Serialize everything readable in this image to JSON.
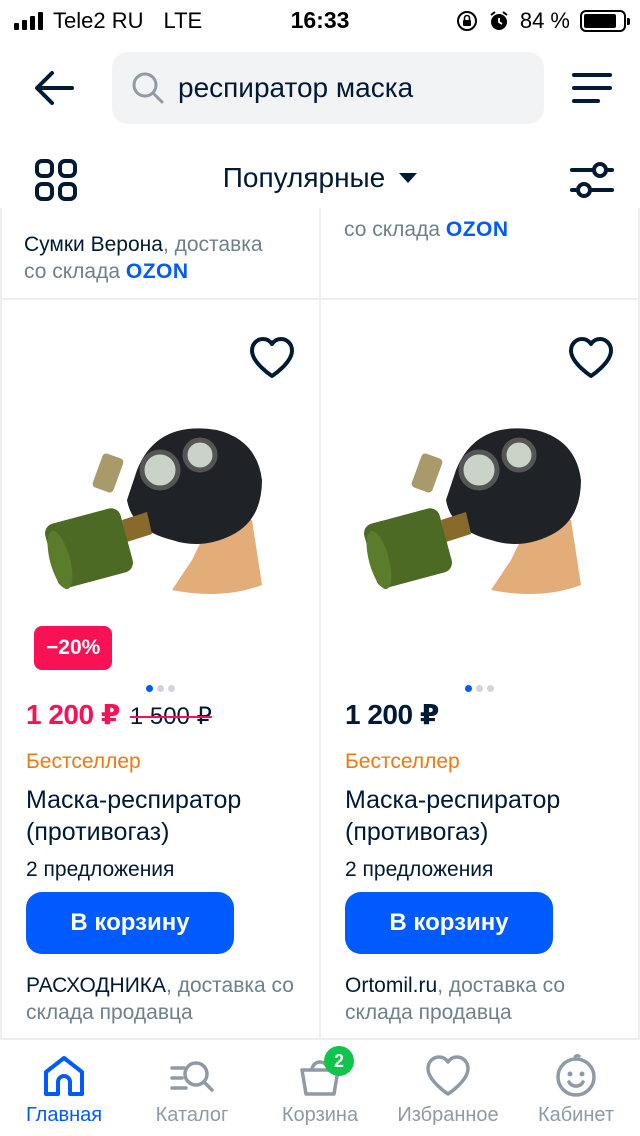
{
  "status_bar": {
    "carrier": "Tele2 RU",
    "network": "LTE",
    "time": "16:33",
    "battery": "84 %",
    "battery_level": 0.84
  },
  "search": {
    "query": "респиратор маска"
  },
  "sort": {
    "label": "Популярные"
  },
  "previous_row": {
    "left_seller_name": "Сумки Верона",
    "left_seller_rest": ", доставка",
    "left_seller_line2": "со склада ",
    "right_seller_line": "со склада ",
    "ozon": "OZON"
  },
  "products": [
    {
      "discount": "−20%",
      "price": "1 200 ₽",
      "old_price": "1 500 ₽",
      "bestseller": "Бестселлер",
      "title": "Маска-респиратор (противогаз)",
      "offers": "2 предложения",
      "cart_button": "В корзину",
      "seller_name": "РАСХОДНИКА",
      "seller_rest": ", доставка со склада продавца"
    },
    {
      "price": "1 200 ₽",
      "bestseller": "Бестселлер",
      "title": "Маска-респиратор (противогаз)",
      "offers": "2 предложения",
      "cart_button": "В корзину",
      "seller_name": "Ortomil.ru",
      "seller_rest": ", доставка со склада продавца"
    }
  ],
  "tabbar": {
    "home": "Главная",
    "catalog": "Каталог",
    "cart": "Корзина",
    "cart_count": "2",
    "favorites": "Избранное",
    "account": "Кабинет"
  },
  "colors": {
    "accent": "#005bff",
    "sale": "#f91155",
    "bestseller": "#f1780d",
    "badge_green": "#10c44c"
  }
}
